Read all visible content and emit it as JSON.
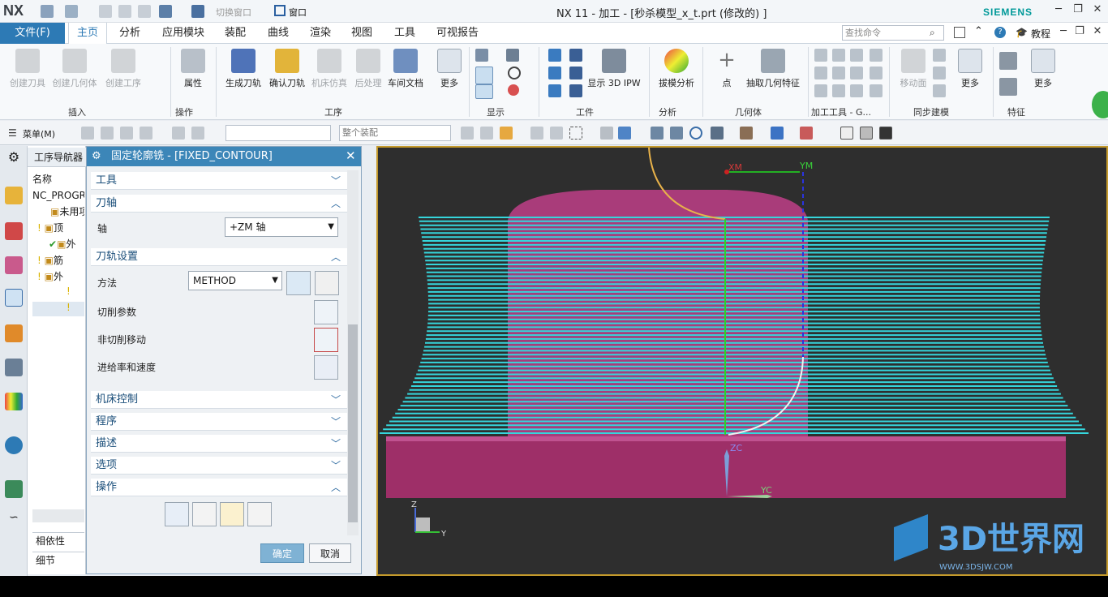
{
  "app": {
    "logo": "NX",
    "window_title": "NX 11 - 加工 - [秒杀模型_x_t.prt  (修改的) ]",
    "brand": "SIEMENS",
    "quick_access": {
      "switch_window": "切换窗口",
      "window": "窗口"
    }
  },
  "menubar": {
    "file": "文件(F)",
    "tabs": [
      "主页",
      "分析",
      "应用模块",
      "装配",
      "曲线",
      "渲染",
      "视图",
      "工具",
      "可视报告"
    ],
    "active_tab": "主页",
    "search_placeholder": "查找命令",
    "tutorial": "教程"
  },
  "ribbon": {
    "buttons": {
      "create_tool": "创建刀具",
      "create_geometry": "创建几何体",
      "create_operation": "创建工序",
      "properties": "属性",
      "generate_path": "生成刀轨",
      "verify_path": "确认刀轨",
      "machine_sim": "机床仿真",
      "postprocess": "后处理",
      "shop_doc": "车间文档",
      "more1": "更多",
      "show_ipw": "显示 3D IPW",
      "draft_analysis": "拔模分析",
      "point": "点",
      "extract_geometry": "抽取几何特征",
      "move_face": "移动面",
      "more2": "更多",
      "more3": "更多"
    },
    "groups": {
      "insert": "插入",
      "operation": "操作",
      "process": "工序",
      "display": "显示",
      "workpiece": "工件",
      "analysis": "分析",
      "geometry": "几何体",
      "machining_tools": "加工工具 - G...",
      "sync_modeling": "同步建模",
      "feature": "特征"
    }
  },
  "toolbar2": {
    "menu": "菜单(M)",
    "filter_placeholder": "",
    "assembly_filter": "整个装配"
  },
  "navigator": {
    "title": "工序导航器",
    "column": "名称",
    "rows": [
      "NC_PROGR",
      "未用项",
      "顶",
      "外",
      "筋",
      "外"
    ],
    "bottom": [
      "相依性",
      "细节"
    ]
  },
  "dialog": {
    "title": "固定轮廓铣 - [FIXED_CONTOUR]",
    "sections": {
      "tool": "工具",
      "tool_axis": "刀轴",
      "path_settings": "刀轨设置",
      "machine_control": "机床控制",
      "program": "程序",
      "description": "描述",
      "options": "选项",
      "actions": "操作"
    },
    "axis_label": "轴",
    "axis_value": "+ZM 轴",
    "method_label": "方法",
    "method_value": "METHOD",
    "cut_params": "切削参数",
    "non_cut_moves": "非切削移动",
    "feeds_speeds": "进给率和速度",
    "ok": "确定",
    "cancel": "取消"
  },
  "graphics": {
    "labels": {
      "xm": "XM",
      "ym": "YM",
      "zc": "ZC",
      "yc": "YC",
      "triad_z": "Z",
      "triad_y": "Y"
    },
    "watermark": "3D世界网",
    "watermark_url": "WWW.3DSJW.COM",
    "colors": {
      "part": "#b0417c",
      "toolpath": "#35d6dc",
      "background": "#2e2e2e"
    }
  }
}
